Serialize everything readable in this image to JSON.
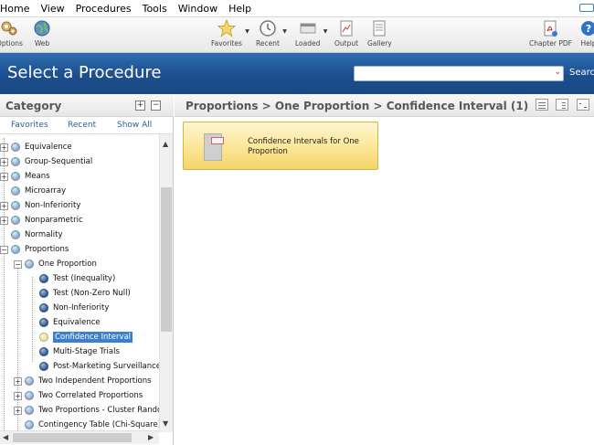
{
  "menubar": {
    "items": [
      "Home",
      "View",
      "Procedures",
      "Tools",
      "Window",
      "Help"
    ]
  },
  "toolbar": {
    "options": "Options",
    "web": "Web",
    "favorites": "Favorites",
    "recent": "Recent",
    "loaded": "Loaded",
    "output": "Output",
    "gallery": "Gallery",
    "chapter_pdf": "Chapter PDF",
    "help": "Help"
  },
  "header": {
    "title": "Select a Procedure",
    "search_value": "",
    "search_button": "Search"
  },
  "category": {
    "title": "Category",
    "tabs": [
      "Favorites",
      "Recent",
      "Show All"
    ]
  },
  "tree": [
    {
      "label": "Equivalence"
    },
    {
      "label": "Group-Sequential"
    },
    {
      "label": "Means"
    },
    {
      "label": "Microarray"
    },
    {
      "label": "Non-Inferiority"
    },
    {
      "label": "Nonparametric"
    },
    {
      "label": "Normality"
    },
    {
      "label": "Proportions"
    },
    {
      "label": "One Proportion"
    },
    {
      "label": "Test (Inequality)"
    },
    {
      "label": "Test (Non-Zero Null)"
    },
    {
      "label": "Non-Inferiority"
    },
    {
      "label": "Equivalence"
    },
    {
      "label": "Confidence Interval"
    },
    {
      "label": "Multi-Stage Trials"
    },
    {
      "label": "Post-Marketing Surveillance"
    },
    {
      "label": "Two Independent Proportions"
    },
    {
      "label": "Two Correlated Proportions"
    },
    {
      "label": "Two Proportions - Cluster Random"
    },
    {
      "label": "Contingency Table (Chi-Square)"
    }
  ],
  "breadcrumb": "Proportions > One Proportion > Confidence Interval (1)",
  "procedures": [
    {
      "label": "Confidence Intervals for One Proportion"
    }
  ],
  "colors": {
    "header_blue": "#1c4e8e",
    "selected_blue": "#3c7fd0",
    "card_yellow": "#fbe491"
  }
}
